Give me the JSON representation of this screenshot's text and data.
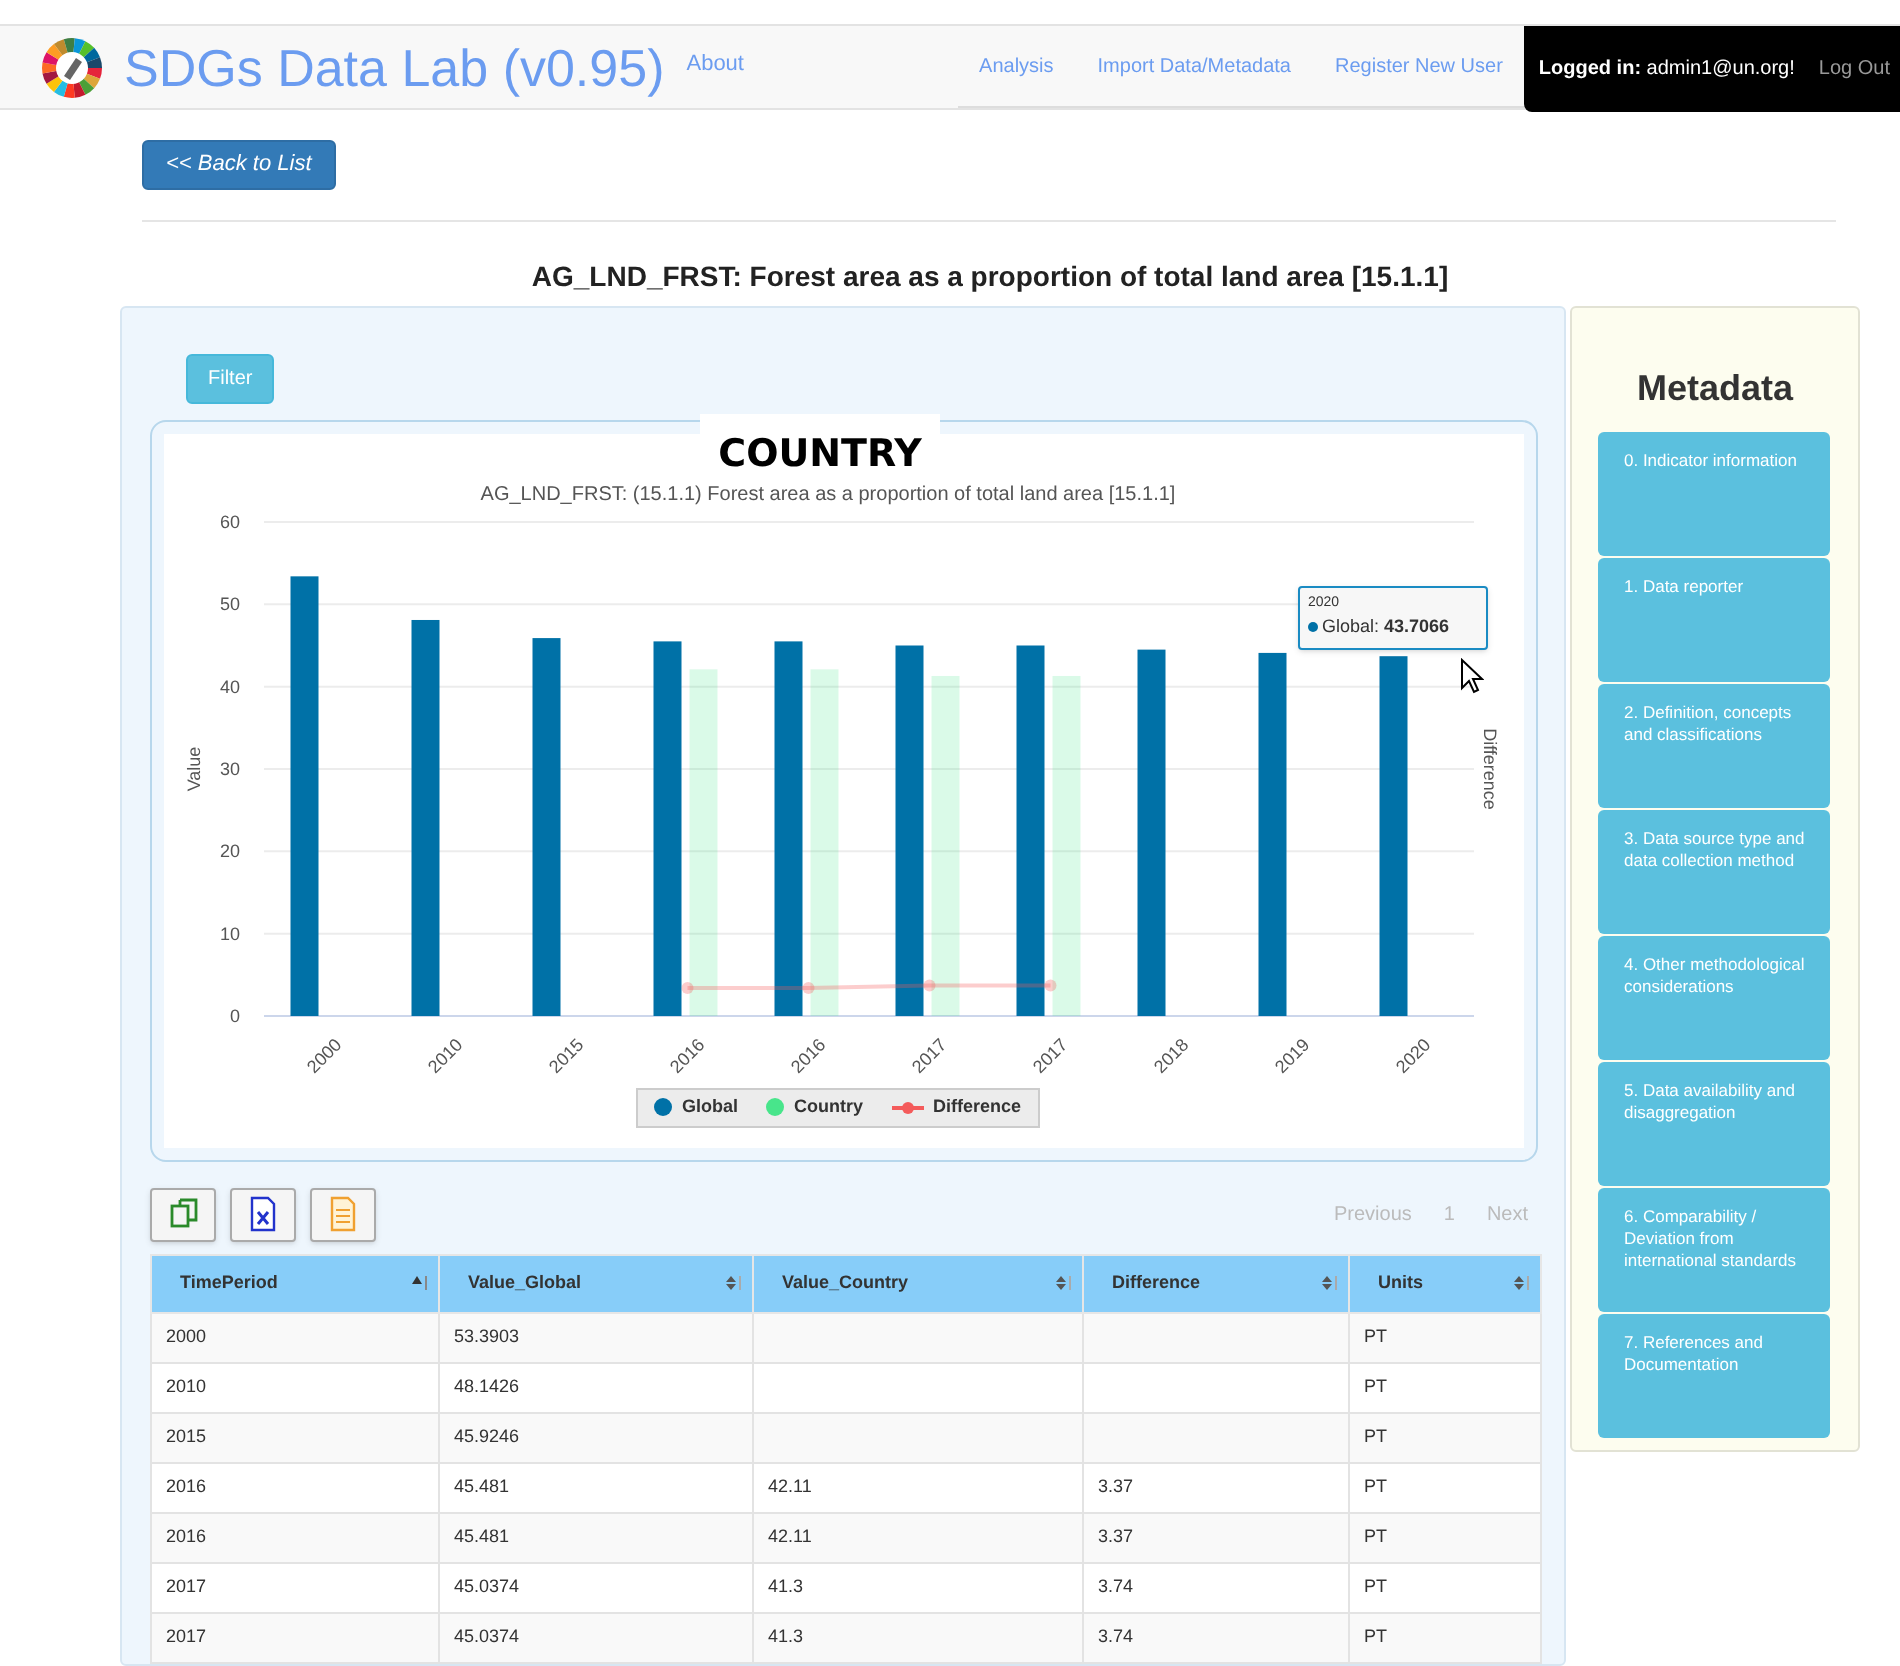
{
  "navbar": {
    "brand": "SDGs Data Lab (v0.95)",
    "about": "About",
    "links": [
      "Analysis",
      "Import Data/Metadata",
      "Register New User"
    ],
    "login_label": "Logged in:",
    "login_user": "admin1@un.org!",
    "logout": "Log Out"
  },
  "back_button": "<< Back to List",
  "page_title": "AG_LND_FRST: Forest area as a proportion of total land area [15.1.1]",
  "filter_button": "Filter",
  "chart_panel": {
    "country_label": "COUNTRY",
    "tooltip": {
      "title": "2020",
      "series": "Global: ",
      "value": "43.7066"
    },
    "chart_data": {
      "type": "bar",
      "title": "AG_LND_FRST: (15.1.1) Forest area as a proportion of total land area [15.1.1]",
      "ylabel": "Value",
      "y2label": "Difference",
      "categories": [
        "2000",
        "2010",
        "2015",
        "2016",
        "2016",
        "2017",
        "2017",
        "2018",
        "2019",
        "2020"
      ],
      "series": [
        {
          "name": "Global",
          "color": "#0071a7",
          "type": "bar",
          "values": [
            53.4,
            48.1,
            45.9,
            45.5,
            45.5,
            45.0,
            45.0,
            44.5,
            44.1,
            43.7
          ]
        },
        {
          "name": "Country",
          "color": "#48e58b",
          "type": "bar",
          "values": [
            null,
            null,
            null,
            42.1,
            42.1,
            41.3,
            41.3,
            null,
            null,
            null
          ]
        },
        {
          "name": "Difference",
          "color": "#f45b5b",
          "type": "line",
          "marker": "circle",
          "values": [
            null,
            null,
            null,
            3.4,
            3.4,
            3.7,
            3.7,
            null,
            null,
            null
          ]
        }
      ],
      "grid": true,
      "legend": "bottom",
      "ylim": [
        0,
        60
      ],
      "yticks": [
        0,
        10,
        20,
        30,
        40,
        50,
        60
      ]
    }
  },
  "pager": {
    "previous": "Previous",
    "page": "1",
    "next": "Next"
  },
  "table": {
    "columns": [
      {
        "label": "TimePeriod",
        "sorted_ascending": true
      },
      {
        "label": "Value_Global",
        "sorted_ascending": false
      },
      {
        "label": "Value_Country",
        "sorted_ascending": false
      },
      {
        "label": "Difference",
        "sorted_ascending": false
      },
      {
        "label": "Units",
        "sorted_ascending": false
      }
    ],
    "rows": [
      [
        "2000",
        "53.3903",
        "",
        "",
        "PT"
      ],
      [
        "2010",
        "48.1426",
        "",
        "",
        "PT"
      ],
      [
        "2015",
        "45.9246",
        "",
        "",
        "PT"
      ],
      [
        "2016",
        "45.481",
        "42.11",
        "3.37",
        "PT"
      ],
      [
        "2016",
        "45.481",
        "42.11",
        "3.37",
        "PT"
      ],
      [
        "2017",
        "45.0374",
        "41.3",
        "3.74",
        "PT"
      ],
      [
        "2017",
        "45.0374",
        "41.3",
        "3.74",
        "PT"
      ]
    ]
  },
  "metadata": {
    "title": "Metadata",
    "items": [
      "0. Indicator information",
      "1. Data reporter",
      "2. Definition, concepts and classifications",
      "3. Data source type and data collection method",
      "4. Other methodological considerations",
      "5. Data availability and disaggregation",
      "6. Comparability / Deviation from international standards",
      "7. References and Documentation"
    ]
  }
}
